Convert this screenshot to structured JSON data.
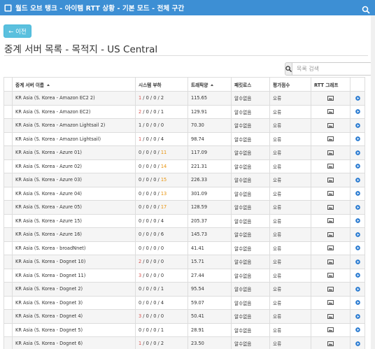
{
  "header": {
    "title": "월드 오브 탱크 - 아이템 RTT 상황 - 기본 모드 - 전체 구간",
    "background": "#3d8fd4"
  },
  "back_button": {
    "label": "← 이전"
  },
  "page_title": "중계 서버 목록 - 목적지 - US Central",
  "search": {
    "placeholder": "목록 검색"
  },
  "table": {
    "headers": [
      "중계 서버 이름",
      "시스템 부하",
      "트래픽양",
      "패킷로스",
      "평가점수",
      "RTT 그래프",
      ""
    ],
    "rows": [
      {
        "name": "KR Asia (S. Korea - Amazon EC2 2)",
        "load_first": "1",
        "load_first_color": "red",
        "load_mid": "0 / 0 /",
        "load_last": "2",
        "load_last_color": "none",
        "traffic": "115.65",
        "loss": "알수없음",
        "score": "오류"
      },
      {
        "name": "KR Asia (S. Korea - Amazon EC2)",
        "load_first": "2",
        "load_first_color": "red",
        "load_mid": "0 / 0 /",
        "load_last": "1",
        "load_last_color": "none",
        "traffic": "129.91",
        "loss": "알수없음",
        "score": "오류"
      },
      {
        "name": "KR Asia (S. Korea - Amazon Lightsail 2)",
        "load_first": "1",
        "load_first_color": "none",
        "load_mid": "0 / 0 /",
        "load_last": "0",
        "load_last_color": "none",
        "traffic": "70.30",
        "loss": "알수없음",
        "score": "오류"
      },
      {
        "name": "KR Asia (S. Korea - Amazon Lightsail)",
        "load_first": "1",
        "load_first_color": "red",
        "load_mid": "0 / 0 /",
        "load_last": "4",
        "load_last_color": "none",
        "traffic": "98.74",
        "loss": "알수없음",
        "score": "오류"
      },
      {
        "name": "KR Asia (S. Korea - Azure 01)",
        "load_first": "0",
        "load_first_color": "none",
        "load_mid": "0 / 0 /",
        "load_last": "11",
        "load_last_color": "orange",
        "traffic": "117.09",
        "loss": "알수없음",
        "score": "오류"
      },
      {
        "name": "KR Asia (S. Korea - Azure 02)",
        "load_first": "0",
        "load_first_color": "none",
        "load_mid": "0 / 0 /",
        "load_last": "14",
        "load_last_color": "orange",
        "traffic": "221.31",
        "loss": "알수없음",
        "score": "오류"
      },
      {
        "name": "KR Asia (S. Korea - Azure 03)",
        "load_first": "0",
        "load_first_color": "none",
        "load_mid": "0 / 0 /",
        "load_last": "15",
        "load_last_color": "orange",
        "traffic": "226.33",
        "loss": "알수없음",
        "score": "오류"
      },
      {
        "name": "KR Asia (S. Korea - Azure 04)",
        "load_first": "0",
        "load_first_color": "none",
        "load_mid": "0 / 0 /",
        "load_last": "13",
        "load_last_color": "orange",
        "traffic": "301.09",
        "loss": "알수없음",
        "score": "오류"
      },
      {
        "name": "KR Asia (S. Korea - Azure 05)",
        "load_first": "0",
        "load_first_color": "none",
        "load_mid": "0 / 0 /",
        "load_last": "17",
        "load_last_color": "orange",
        "traffic": "128.59",
        "loss": "알수없음",
        "score": "오류"
      },
      {
        "name": "KR Asia (S. Korea - Azure 15)",
        "load_first": "0",
        "load_first_color": "none",
        "load_mid": "0 / 0 /",
        "load_last": "4",
        "load_last_color": "none",
        "traffic": "205.37",
        "loss": "알수없음",
        "score": "오류"
      },
      {
        "name": "KR Asia (S. Korea - Azure 16)",
        "load_first": "0",
        "load_first_color": "none",
        "load_mid": "0 / 0 /",
        "load_last": "6",
        "load_last_color": "none",
        "traffic": "145.73",
        "loss": "알수없음",
        "score": "오류"
      },
      {
        "name": "KR Asia (S. Korea - broadNnet)",
        "load_first": "0",
        "load_first_color": "none",
        "load_mid": "0 / 0 /",
        "load_last": "0",
        "load_last_color": "none",
        "traffic": "41.41",
        "loss": "알수없음",
        "score": "오류"
      },
      {
        "name": "KR Asia (S. Korea - Dognet 10)",
        "load_first": "2",
        "load_first_color": "red",
        "load_mid": "0 / 0 /",
        "load_last": "0",
        "load_last_color": "none",
        "traffic": "15.71",
        "loss": "알수없음",
        "score": "오류"
      },
      {
        "name": "KR Asia (S. Korea - Dognet 11)",
        "load_first": "3",
        "load_first_color": "red",
        "load_mid": "0 / 0 /",
        "load_last": "0",
        "load_last_color": "none",
        "traffic": "27.44",
        "loss": "알수없음",
        "score": "오류"
      },
      {
        "name": "KR Asia (S. Korea - Dognet 2)",
        "load_first": "0",
        "load_first_color": "none",
        "load_mid": "0 / 0 /",
        "load_last": "1",
        "load_last_color": "none",
        "traffic": "95.54",
        "loss": "알수없음",
        "score": "오류"
      },
      {
        "name": "KR Asia (S. Korea - Dognet 3)",
        "load_first": "0",
        "load_first_color": "none",
        "load_mid": "0 / 0 /",
        "load_last": "4",
        "load_last_color": "none",
        "traffic": "59.07",
        "loss": "알수없음",
        "score": "오류"
      },
      {
        "name": "KR Asia (S. Korea - Dognet 4)",
        "load_first": "3",
        "load_first_color": "red",
        "load_mid": "0 / 0 /",
        "load_last": "0",
        "load_last_color": "none",
        "traffic": "50.41",
        "loss": "알수없음",
        "score": "오류"
      },
      {
        "name": "KR Asia (S. Korea - Dognet 5)",
        "load_first": "0",
        "load_first_color": "none",
        "load_mid": "0 / 0 /",
        "load_last": "1",
        "load_last_color": "none",
        "traffic": "28.91",
        "loss": "알수없음",
        "score": "오류"
      },
      {
        "name": "KR Asia (S. Korea - Dognet 6)",
        "load_first": "1",
        "load_first_color": "red",
        "load_mid": "0 / 0 /",
        "load_last": "2",
        "load_last_color": "none",
        "traffic": "23.50",
        "loss": "알수없음",
        "score": "오류"
      }
    ]
  },
  "colors": {
    "load_red": "#d9534f",
    "load_orange": "#e8930c",
    "action_blue": "#2a7bd1",
    "back_button": "#5bc0de"
  },
  "icons": {
    "graph": "chart-image-icon",
    "action": "play-circle-icon",
    "search": "search-icon"
  }
}
